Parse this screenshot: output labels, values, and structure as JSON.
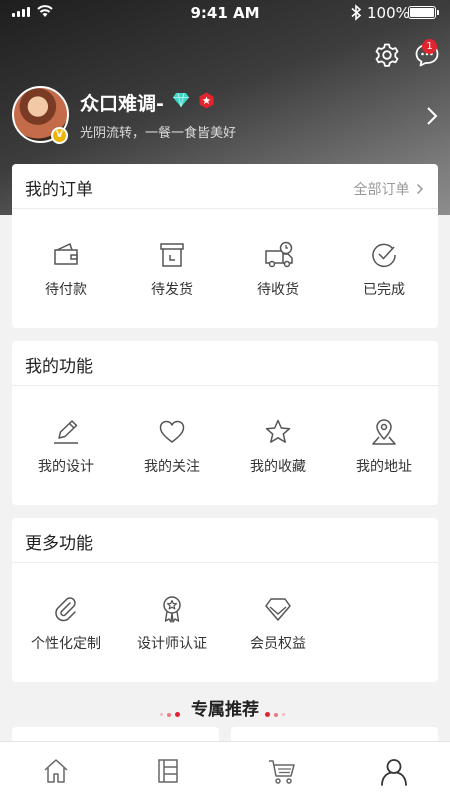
{
  "status_bar": {
    "time": "9:41 AM",
    "battery": "100%"
  },
  "header": {
    "username": "众口难调-",
    "motto": "光阴流转，一餐一食皆美好",
    "message_badge": "1"
  },
  "orders": {
    "title": "我的订单",
    "more_label": "全部订单",
    "items": [
      {
        "label": "待付款",
        "icon": "wallet-icon"
      },
      {
        "label": "待发货",
        "icon": "box-icon"
      },
      {
        "label": "待收货",
        "icon": "truck-icon"
      },
      {
        "label": "已完成",
        "icon": "check-circle-icon"
      }
    ]
  },
  "functions": {
    "title": "我的功能",
    "items": [
      {
        "label": "我的设计",
        "icon": "pencil-icon"
      },
      {
        "label": "我的关注",
        "icon": "heart-icon"
      },
      {
        "label": "我的收藏",
        "icon": "star-icon"
      },
      {
        "label": "我的地址",
        "icon": "location-icon"
      }
    ]
  },
  "more_functions": {
    "title": "更多功能",
    "items": [
      {
        "label": "个性化定制",
        "icon": "paperclip-icon"
      },
      {
        "label": "设计师认证",
        "icon": "medal-icon"
      },
      {
        "label": "会员权益",
        "icon": "diamond-icon"
      }
    ]
  },
  "recommend": {
    "title": "专属推荐"
  },
  "tabbar": {
    "tabs": [
      {
        "name": "home",
        "icon": "home-icon"
      },
      {
        "name": "category",
        "icon": "grid-book-icon"
      },
      {
        "name": "cart",
        "icon": "cart-icon"
      },
      {
        "name": "profile",
        "icon": "user-icon"
      }
    ]
  },
  "colors": {
    "accent": "#e0252f",
    "gem": "#3fd6c8",
    "gold": "#f0b400"
  }
}
